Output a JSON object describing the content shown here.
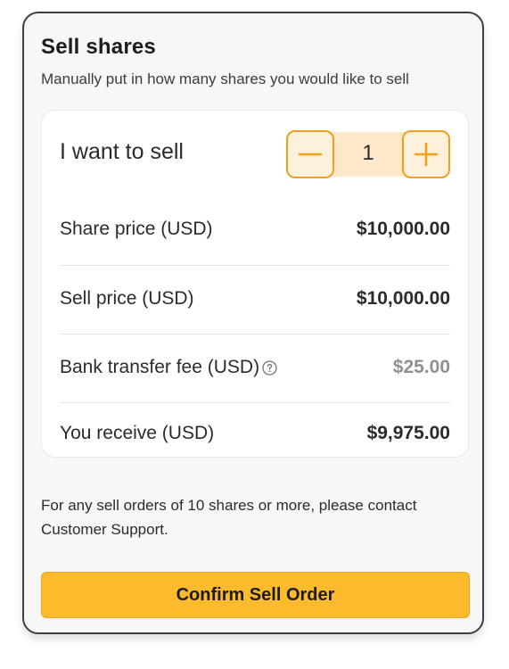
{
  "panel": {
    "title": "Sell shares",
    "subtitle": "Manually put in how many shares you would like to sell"
  },
  "sell_input": {
    "label": "I want to sell",
    "quantity": "1",
    "decrement_icon": "minus-icon",
    "increment_icon": "plus-icon"
  },
  "summary": {
    "share_price_label": "Share price (USD)",
    "share_price_value": "$10,000.00",
    "sell_price_label": "Sell price (USD)",
    "sell_price_value": "$10,000.00",
    "fee_label": "Bank transfer fee (USD)",
    "fee_icon": "question-circle-icon",
    "fee_value": "$25.00",
    "receive_label": "You receive (USD)",
    "receive_value": "$9,975.00"
  },
  "note": "For any sell orders of 10 shares or more, please contact Customer Support.",
  "confirm_label": "Confirm Sell Order",
  "colors": {
    "accent": "#f0a01a",
    "accent_fill": "#fde9c9",
    "button": "#fbbb2d",
    "muted_value": "#8e9096"
  }
}
